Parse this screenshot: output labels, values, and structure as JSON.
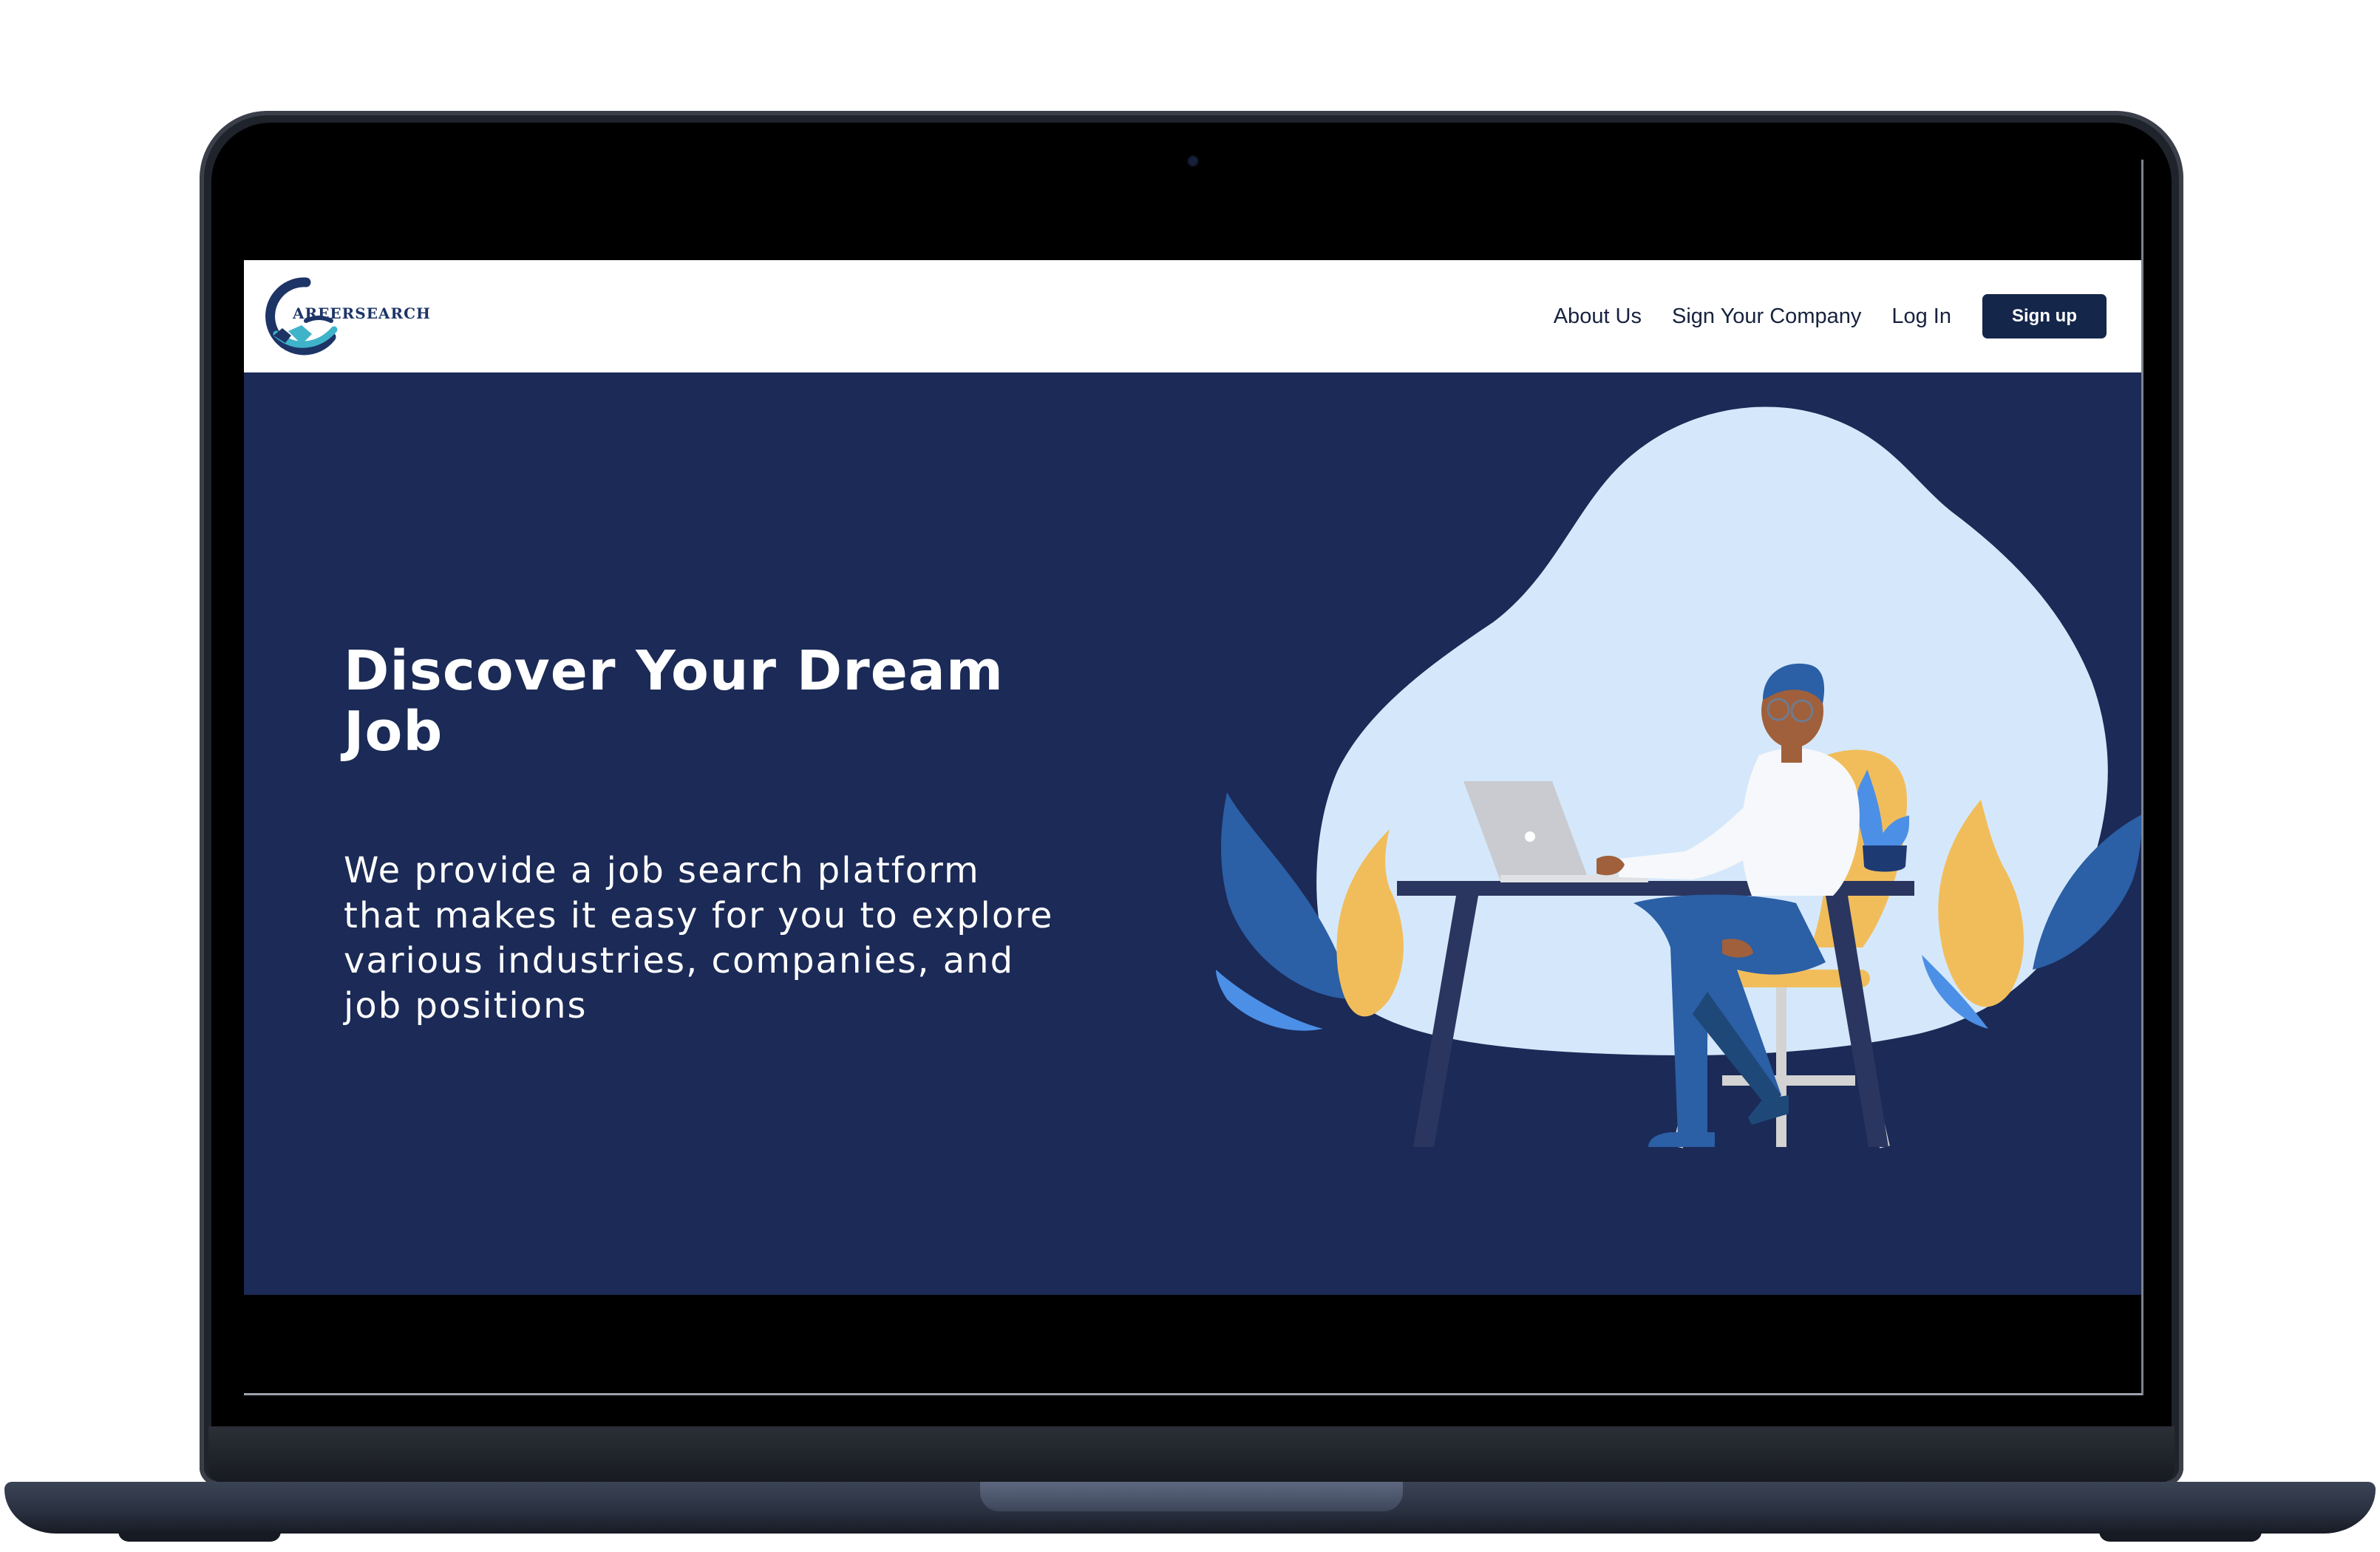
{
  "site": {
    "logo_text": "AREERSEARCH"
  },
  "nav": {
    "links": [
      "About Us",
      "Sign Your Company",
      "Log In"
    ],
    "signup_label": "Sign up"
  },
  "hero": {
    "title": "Discover Your Dream Job",
    "description": "We provide a job search platform that makes it easy for you to explore various industries, companies, and job positions"
  },
  "colors": {
    "hero_background": "#1b2a56",
    "navbar_background": "#ffffff",
    "signup_button": "#14264a",
    "illustration_blob": "#d5e8fb",
    "accent_yellow": "#f1bd5b",
    "accent_blue": "#2b5fa6"
  },
  "icons": {
    "logo": "careersearch-handshake-logo",
    "illustration": "person-working-at-laptop"
  }
}
